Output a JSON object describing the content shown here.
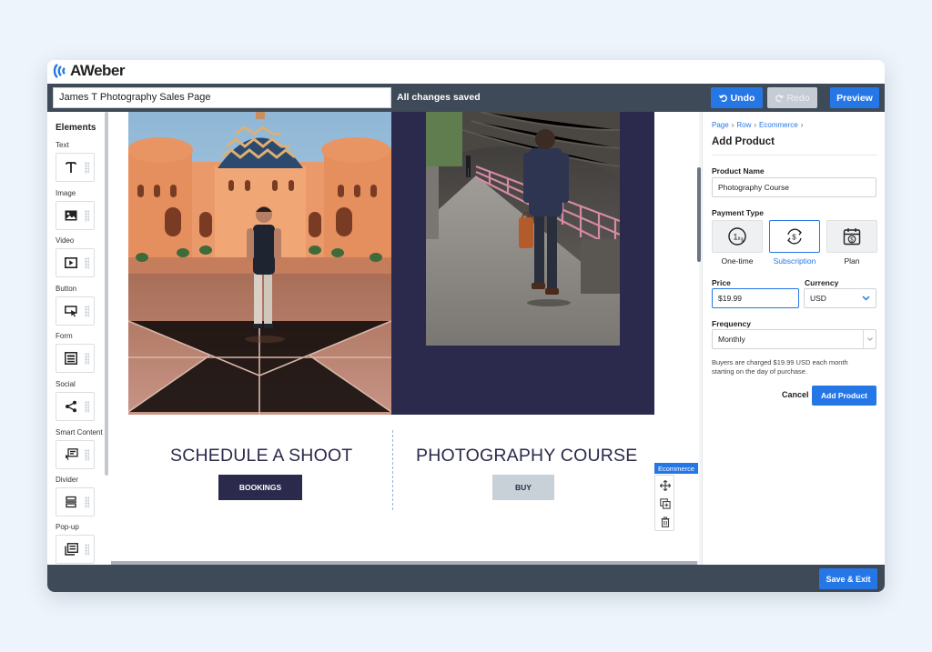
{
  "app": {
    "logo_text": "AWeber"
  },
  "topbar": {
    "page_name": "James T Photography Sales Page",
    "status": "All changes saved",
    "undo_label": "Undo",
    "redo_label": "Redo",
    "preview_label": "Preview"
  },
  "elements": {
    "title": "Elements",
    "items": [
      {
        "label": "Text",
        "icon": "text-icon"
      },
      {
        "label": "Image",
        "icon": "image-icon"
      },
      {
        "label": "Video",
        "icon": "video-icon"
      },
      {
        "label": "Button",
        "icon": "button-icon"
      },
      {
        "label": "Form",
        "icon": "form-icon"
      },
      {
        "label": "Social",
        "icon": "share-icon"
      },
      {
        "label": "Smart Content",
        "icon": "smart-content-icon"
      },
      {
        "label": "Divider",
        "icon": "divider-icon"
      },
      {
        "label": "Pop-up",
        "icon": "popup-icon"
      }
    ]
  },
  "canvas": {
    "left_heading": "SCHEDULE A SHOOT",
    "left_button": "BOOKINGS",
    "right_heading": "PHOTOGRAPHY COURSE",
    "right_button": "BUY",
    "ecommerce_tag": "Ecommerce"
  },
  "panel": {
    "breadcrumbs": [
      "Page",
      "Row",
      "Ecommerce"
    ],
    "title": "Add Product",
    "product_name_label": "Product Name",
    "product_name_value": "Photography Course",
    "payment_type_label": "Payment Type",
    "payment_types": [
      {
        "label": "One-time",
        "icon": "one-time-icon",
        "selected": false
      },
      {
        "label": "Subscription",
        "icon": "subscription-icon",
        "selected": true
      },
      {
        "label": "Plan",
        "icon": "plan-calendar-icon",
        "selected": false
      }
    ],
    "price_label": "Price",
    "price_value": "$19.99",
    "currency_label": "Currency",
    "currency_value": "USD",
    "frequency_label": "Frequency",
    "frequency_value": "Monthly",
    "hint": "Buyers are charged $19.99 USD each month starting on the day of purchase.",
    "cancel_label": "Cancel",
    "add_label": "Add Product"
  },
  "bottombar": {
    "save_exit_label": "Save & Exit"
  },
  "colors": {
    "accent": "#2677e6",
    "navy": "#2b2a4c",
    "toolbar": "#3e4a57"
  }
}
